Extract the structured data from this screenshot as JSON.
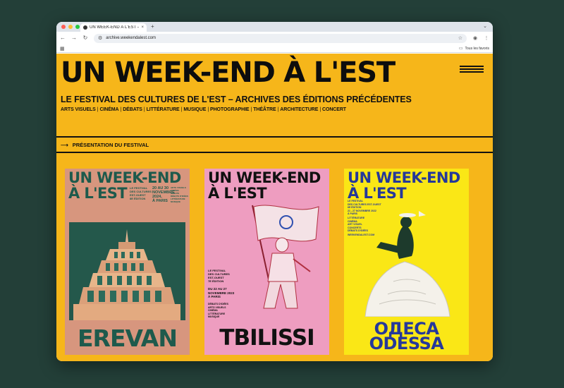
{
  "browser": {
    "tab_title": "UN WEEK-END À L'EST – LE",
    "tab_close": "×",
    "new_tab": "+",
    "tabs_menu": "⌄",
    "url": "archive.weekendalest.com",
    "bookmarks_folder": "Tous les favoris",
    "traffic_colors": [
      "#ff5f57",
      "#febc2e",
      "#28c840"
    ]
  },
  "site": {
    "title": "UN WEEK-END À L'EST",
    "subtitle": "LE FESTIVAL DES CULTURES DE L'EST – ARCHIVES DES ÉDITIONS PRÉCÉDENTES",
    "categories": [
      "ARTS VISUELS",
      "CINÉMA",
      "DÉBATS",
      "LITTÉRATURE",
      "MUSIQUE",
      "PHOTOGRAPHIE",
      "THÉÂTRE",
      "ARCHITECTURE",
      "CONCERT"
    ],
    "presentation_arrow": "⟶",
    "presentation_link": "PRÉSENTATION DU FESTIVAL",
    "background": "#f6b61a"
  },
  "posters": [
    {
      "heading_1": "UN WEEK-END",
      "heading_2": "À L'EST",
      "info_a": "LE FESTIVAL\nDES CULTURES\nEST-OUEST\n8E ÉDITION",
      "info_b": "20 AU 30\nNOVEMBRE\n2024,\nÀ PARIS",
      "info_c": "ARTS VISUELS\nCINÉMA\nDÉBATS\nDÉBATS D'IDÉES\nLITTÉRATURE\nMUSIQUE",
      "city": "EREVAN",
      "background": "#d7967e"
    },
    {
      "heading_1": "UN WEEK-END",
      "heading_2": "À L'EST",
      "info_a": "LE FESTIVAL\nDES CULTURES\nEST-OUEST\n7E ÉDITION",
      "info_b": "DU 22 AU 27\nNOVEMBRE 2023\nÀ PARIS",
      "info_c": "DÉBATS D'IDÉES\nARTS VISUELS\nCINÉMA\nLITTÉRATURE\nMUSIQUE",
      "city": "TBILISSI",
      "background": "#ee9dc0"
    },
    {
      "heading_1": "UN WEEK-END",
      "heading_2": "À L'EST",
      "info_a": "LE FESTIVAL\nDES CULTURES EST-OUEST\n6E ÉDITION\n21 - 27 NOVEMBRE 2022\nÀ PARIS",
      "info_c": "LITTÉRATURE\nCINÉMA\nART VISUEL\nCONCERTS\nDÉBATS D'IDÉES",
      "website": "WEEKENDALEST.COM",
      "city_1": "ОДЕСА",
      "city_2": "ODESSA",
      "background": "#fae716"
    }
  ]
}
